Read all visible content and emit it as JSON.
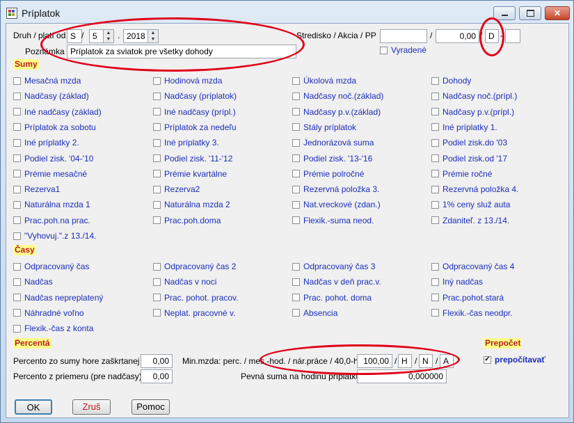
{
  "window": {
    "title": "Príplatok",
    "minimize_icon": "minimize-icon",
    "maximize_icon": "maximize-icon",
    "close_icon": "close-icon"
  },
  "header": {
    "druh_label": "Druh / platí od",
    "druh_value": "S",
    "sep": "/",
    "month_value": "5",
    "dot": ".",
    "year_value": "2018",
    "poznamka_label": "Poznámka",
    "poznamka_value": "Príplatok za sviatok pre všetky dohody",
    "stredisko_label": "Stredisko / Akcia / PP",
    "stredisko_value": "",
    "akcia_value": "0,00",
    "pp_value": "D",
    "dash": "-",
    "pp_extra_value": "",
    "vyradene_label": "Vyradené"
  },
  "sums": {
    "title": "Sumy",
    "items": [
      [
        "Mesačná mzda",
        "Hodinová mzda",
        "Úkolová mzda",
        "Dohody"
      ],
      [
        "Nadčasy (základ)",
        "Nadčasy (príplatok)",
        "Nadčasy noč.(základ)",
        "Nadčasy noč.(prípl.)"
      ],
      [
        "Iné nadčasy (základ)",
        "Iné nadčasy (prípl.)",
        "Nadčasy p.v.(základ)",
        "Nadčasy p.v.(prípl.)"
      ],
      [
        "Príplatok za sobotu",
        "Príplatok za nedeľu",
        "Stály príplatok",
        "Iné príplatky 1."
      ],
      [
        "Iné príplatky 2.",
        "Iné príplatky 3.",
        "Jednorázová suma",
        "Podiel zisk.do '03"
      ],
      [
        "Podiel zisk. '04-'10",
        "Podiel zisk. '11-'12",
        "Podiel zisk. '13-'16",
        "Podiel zisk.od '17"
      ],
      [
        "Prémie mesačné",
        "Prémie kvartálne",
        "Prémie polročné",
        "Prémie ročné"
      ],
      [
        "Rezerva1",
        "Rezerva2",
        "Rezervná položka 3.",
        "Rezervná položka 4."
      ],
      [
        "Naturálna mzda 1",
        "Naturálna mzda 2",
        "Nat.vreckové (zdan.)",
        "1% ceny služ auta"
      ],
      [
        "Prac.poh.na prac.",
        "Prac.poh.doma",
        "Flexik.-suma neod.",
        "Zdaniteľ. z 13./14."
      ],
      [
        "\"Vyhovuj.\".z 13./14."
      ]
    ]
  },
  "times": {
    "title": "Časy",
    "items": [
      [
        "Odpracovaný čas",
        "Odpracovaný čas 2",
        "Odpracovaný čas 3",
        "Odpracovaný čas 4"
      ],
      [
        "Nadčas",
        "Nadčas v noci",
        "Nadčas v deň prac.v.",
        "Iný nadčas"
      ],
      [
        "Nadčas nepreplatený",
        "Prac. pohot. pracov.",
        "Prac. pohot. doma",
        "Prac.pohot.stará"
      ],
      [
        "Náhradné voľno",
        "Neplat. pracovné v.",
        "Absencia",
        "Flexik.-čas neodpr."
      ],
      [
        "Flexik.-čas z konta"
      ]
    ]
  },
  "percent": {
    "title": "Percentá",
    "zo_sumy_label": "Percento zo sumy hore zaškrtanej",
    "zo_sumy_value": "0,00",
    "z_priemeru_label": "Percento z priemeru (pre nadčasy)",
    "z_priemeru_value": "0,00",
    "minmzda_label": "Min.mzda: perc. / mes.-hod. / nár.práce / 40,0-h",
    "minmzda_value": "100,00",
    "h_value": "H",
    "n_value": "N",
    "a_value": "A",
    "pevna_label": "Pevná suma na hodinu príplatku",
    "pevna_value": "0,000000"
  },
  "prepocet": {
    "title": "Prepočet",
    "checkbox_label": "prepočítavať",
    "checked": true,
    "check_mark": "✓"
  },
  "buttons": {
    "ok": "OK",
    "cancel": "Zruš",
    "help": "Pomoc"
  },
  "icons": {
    "spin_up": "▲",
    "spin_down": "▼"
  }
}
